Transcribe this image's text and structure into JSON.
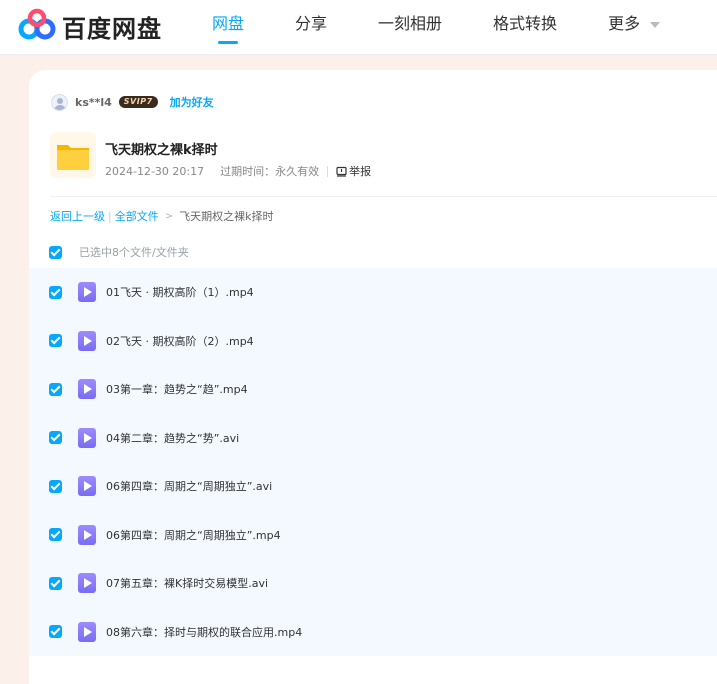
{
  "header": {
    "logo_text": "百度网盘",
    "nav": [
      {
        "label": "网盘",
        "active": true
      },
      {
        "label": "分享",
        "active": false
      },
      {
        "label": "一刻相册",
        "active": false
      },
      {
        "label": "格式转换",
        "active": false
      },
      {
        "label": "更多",
        "active": false
      }
    ]
  },
  "share": {
    "username": "ks**l4",
    "badge": "SVIP7",
    "add_friend": "加为好友",
    "title": "飞天期权之裸k择时",
    "date": "2024-12-30 20:17",
    "expiry": "过期时间：永久有效",
    "report": "举报"
  },
  "breadcrumb": {
    "back": "返回上一级",
    "all_files": "全部文件",
    "current": "飞天期权之裸k择时"
  },
  "selection": {
    "summary": "已选中8个文件/文件夹"
  },
  "files": [
    {
      "name": "01飞天 · 期权高阶（1）.mp4",
      "checked": true
    },
    {
      "name": "02飞天 · 期权高阶（2）.mp4",
      "checked": true
    },
    {
      "name": "03第一章：趋势之“趋”.mp4",
      "checked": true
    },
    {
      "name": "04第二章：趋势之“势”.avi",
      "checked": true
    },
    {
      "name": "06第四章：周期之“周期独立”.avi",
      "checked": true
    },
    {
      "name": "06第四章：周期之“周期独立”.mp4",
      "checked": true
    },
    {
      "name": "07第五章：裸K择时交易模型.avi",
      "checked": true
    },
    {
      "name": "08第六章：择时与期权的联合应用.mp4",
      "checked": true
    }
  ],
  "colors": {
    "accent": "#06a7ff",
    "page_bg": "#fbf0ea",
    "list_bg": "#f3f9ff",
    "video_icon": "#8b7cf8"
  }
}
